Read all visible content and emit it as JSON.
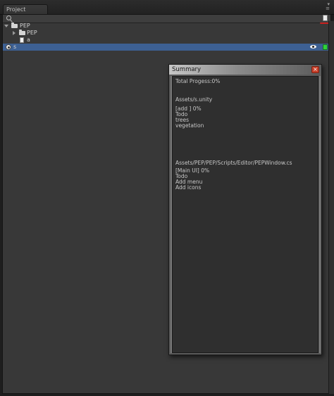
{
  "tabs": [
    {
      "label": "Project"
    }
  ],
  "project_tree": [
    {
      "label": "PEP",
      "indent": 0,
      "expanded": true,
      "icon": "folder-icon"
    },
    {
      "label": "PEP",
      "indent": 1,
      "expanded": false,
      "icon": "folder-icon"
    },
    {
      "label": "a",
      "indent": 1,
      "icon": "file-icon"
    },
    {
      "label": "s",
      "indent": 0,
      "selected": true,
      "icon": "scene-icon"
    }
  ],
  "summary": {
    "title": "Summary",
    "close_label": "×",
    "total_progress": "Total Progess:0%",
    "files": [
      {
        "path": "Assets/s.unity",
        "tag": "[add ] 0%",
        "items": [
          "Todo",
          "trees",
          "vegetation"
        ]
      },
      {
        "path": "Assets/PEP/PEP/Scripts/Editor/PEPWindow.cs",
        "tag": "[Main UI] 0%",
        "items": [
          "Todo",
          "Add menu",
          "Add icons"
        ]
      }
    ]
  },
  "colors": {
    "selection": "#3d6093",
    "panel": "#383838",
    "close": "#c8402a",
    "green_badge": "#2fd33a"
  }
}
